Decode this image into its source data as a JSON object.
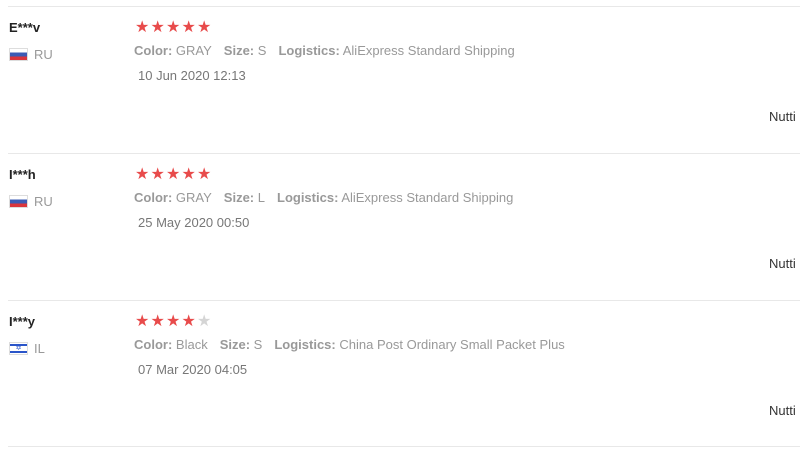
{
  "reviews": [
    {
      "user": "E***v",
      "country": "RU",
      "flag": "ru-flag",
      "rating": 5,
      "color_label": "Color:",
      "color": "GRAY",
      "size_label": "Size:",
      "size": "S",
      "logistics_label": "Logistics:",
      "logistics": "AliExpress Standard Shipping",
      "date": "10 Jun 2020 12:13",
      "right_text": "Nutti"
    },
    {
      "user": "I***h",
      "country": "RU",
      "flag": "ru-flag",
      "rating": 5,
      "color_label": "Color:",
      "color": "GRAY",
      "size_label": "Size:",
      "size": "L",
      "logistics_label": "Logistics:",
      "logistics": "AliExpress Standard Shipping",
      "date": "25 May 2020 00:50",
      "right_text": "Nutti"
    },
    {
      "user": "I***y",
      "country": "IL",
      "flag": "il-flag",
      "rating": 4,
      "color_label": "Color:",
      "color": "Black",
      "size_label": "Size:",
      "size": "S",
      "logistics_label": "Logistics:",
      "logistics": "China Post Ordinary Small Packet Plus",
      "date": "07 Mar 2020 04:05",
      "right_text": "Nutti"
    }
  ],
  "colors": {
    "star_filled": "#e84b4b",
    "star_empty": "#d5d5d5",
    "divider": "#e8e8e8"
  }
}
